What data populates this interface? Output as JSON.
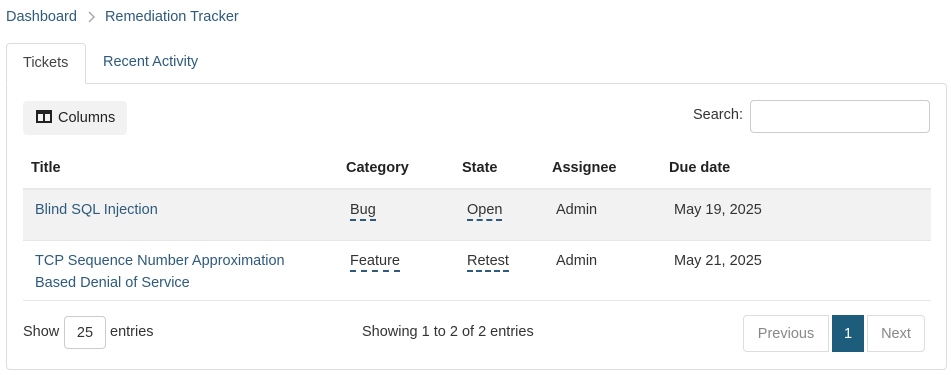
{
  "breadcrumb": {
    "root": "Dashboard",
    "current": "Remediation Tracker"
  },
  "tabs": [
    {
      "label": "Tickets",
      "active": true
    },
    {
      "label": "Recent Activity",
      "active": false
    }
  ],
  "toolbar": {
    "columns_label": "Columns",
    "search_label": "Search:",
    "search_value": ""
  },
  "table": {
    "headers": [
      "Title",
      "Category",
      "State",
      "Assignee",
      "Due date"
    ],
    "rows": [
      {
        "title": "Blind SQL Injection",
        "category": "Bug",
        "state": "Open",
        "assignee": "Admin",
        "due": "May 19, 2025"
      },
      {
        "title_line1": "TCP Sequence Number Approximation",
        "title_line2": "Based Denial of Service",
        "category": "Feature",
        "state": "Retest",
        "assignee": "Admin",
        "due": "May 21, 2025"
      }
    ]
  },
  "footer": {
    "show_label": "Show",
    "page_length": "25",
    "entries_label": "entries",
    "info": "Showing 1 to 2 of 2 entries",
    "previous_label": "Previous",
    "current_page": "1",
    "next_label": "Next"
  },
  "colors": {
    "link": "#2e5a7d",
    "active_page": "#1d5c7a"
  },
  "icons": {
    "breadcrumb_separator": "chevron-right-icon",
    "columns": "columns-icon"
  }
}
